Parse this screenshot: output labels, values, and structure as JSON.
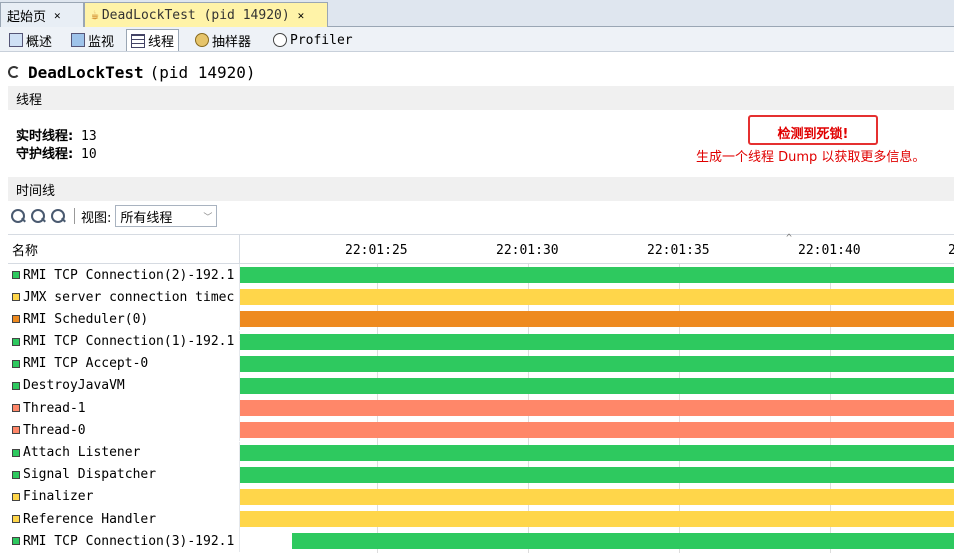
{
  "doc_tabs": [
    {
      "label": "起始页",
      "active": false
    },
    {
      "label": "DeadLockTest (pid 14920)",
      "active": true
    }
  ],
  "sub_tabs": [
    {
      "label": "概述",
      "icon": "overview-icon"
    },
    {
      "label": "监视",
      "icon": "monitor-icon"
    },
    {
      "label": "线程",
      "icon": "threads-icon",
      "active": true
    },
    {
      "label": "抽样器",
      "icon": "sampler-icon"
    },
    {
      "label": "Profiler",
      "icon": "profiler-icon"
    }
  ],
  "title": {
    "app": "DeadLockTest",
    "pid": "(pid 14920)"
  },
  "threads_section": "线程",
  "stats": {
    "live_label": "实时线程:",
    "live_value": "13",
    "daemon_label": "守护线程:",
    "daemon_value": "10"
  },
  "deadlock": {
    "title": "检测到死锁!",
    "message": "生成一个线程 Dump 以获取更多信息。"
  },
  "timeline_section": "时间线",
  "toolbar": {
    "view_label": "视图:",
    "view_value": "所有线程"
  },
  "table": {
    "name_header": "名称",
    "ticks": [
      "22:01:25",
      "22:01:30",
      "22:01:35",
      "22:01:40",
      "2"
    ]
  },
  "colors": {
    "running": "#2ec95f",
    "sleeping": "#ffd64a",
    "waiting": "#ee8a1f",
    "monitor": "#ff8769"
  },
  "threads": [
    {
      "name": "RMI TCP Connection(2)-192.1",
      "state": "running",
      "start": 0
    },
    {
      "name": "JMX server connection timec",
      "state": "sleeping",
      "start": 0
    },
    {
      "name": "RMI Scheduler(0)",
      "state": "waiting",
      "start": 0
    },
    {
      "name": "RMI TCP Connection(1)-192.1",
      "state": "running",
      "start": 0
    },
    {
      "name": "RMI TCP Accept-0",
      "state": "running",
      "start": 0
    },
    {
      "name": "DestroyJavaVM",
      "state": "running",
      "start": 0
    },
    {
      "name": "Thread-1",
      "state": "monitor",
      "start": 0
    },
    {
      "name": "Thread-0",
      "state": "monitor",
      "start": 0
    },
    {
      "name": "Attach Listener",
      "state": "running",
      "start": 0
    },
    {
      "name": "Signal Dispatcher",
      "state": "running",
      "start": 0
    },
    {
      "name": "Finalizer",
      "state": "sleeping",
      "start": 0
    },
    {
      "name": "Reference Handler",
      "state": "sleeping",
      "start": 0
    },
    {
      "name": "RMI TCP Connection(3)-192.1",
      "state": "running",
      "start": 0.073
    }
  ]
}
